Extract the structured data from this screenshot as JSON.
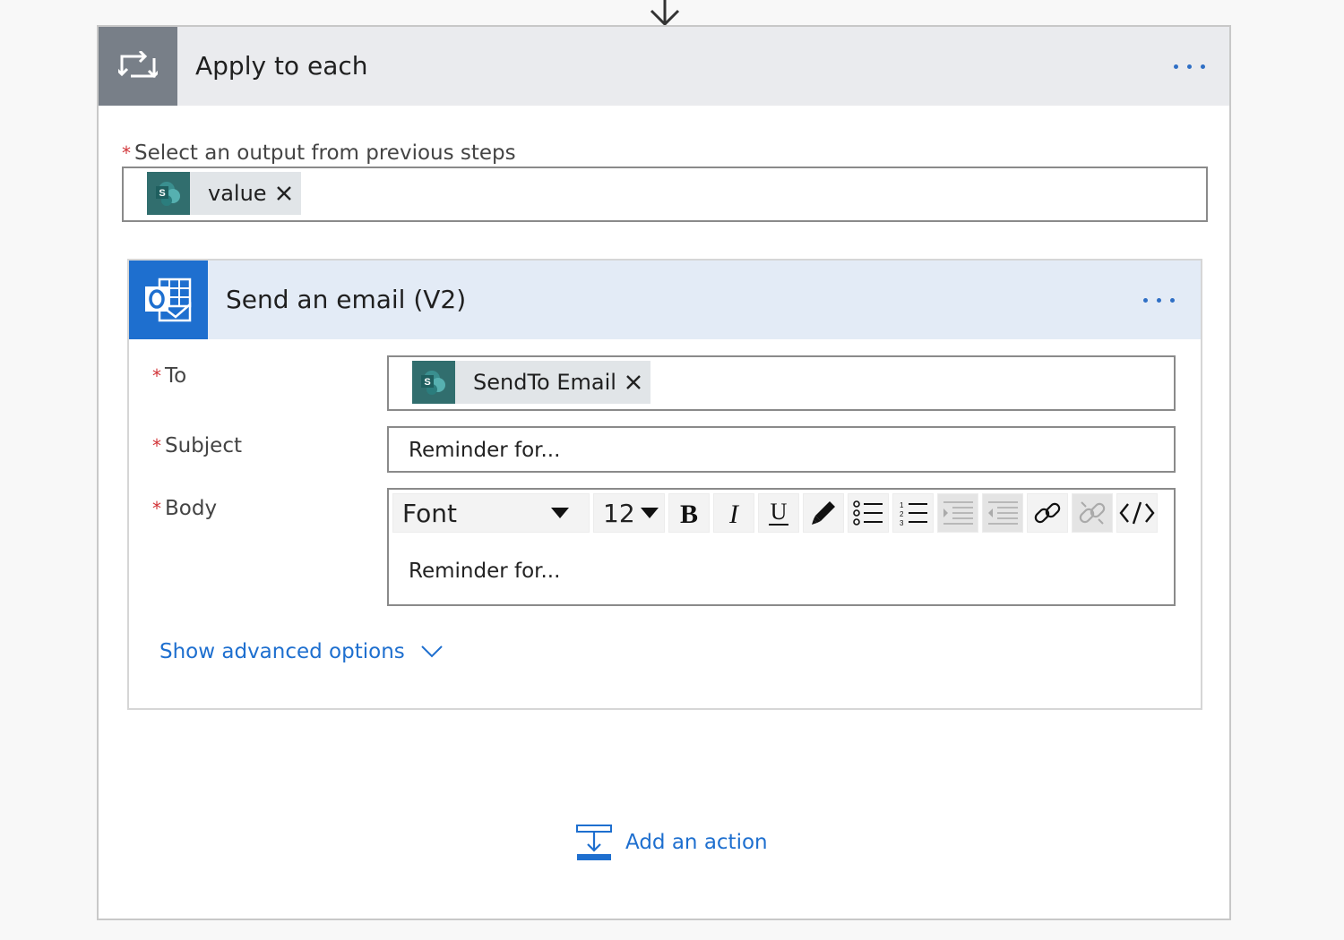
{
  "apply_to_each": {
    "title": "Apply to each",
    "select_output": {
      "required_mark": "*",
      "label": "Select an output from previous steps",
      "token_label": "value"
    }
  },
  "send_email": {
    "title": "Send an email (V2)",
    "to": {
      "required_mark": "*",
      "label": "To",
      "token_label": "SendTo Email"
    },
    "subject": {
      "required_mark": "*",
      "label": "Subject",
      "value": "Reminder for..."
    },
    "body": {
      "required_mark": "*",
      "label": "Body",
      "value": "Reminder for...",
      "toolbar": {
        "font_label": "Font",
        "size_label": "12"
      }
    },
    "show_advanced_label": "Show advanced options"
  },
  "add_action_label": "Add an action",
  "colors": {
    "accent": "#1e6fcf",
    "required": "#d13438",
    "sharepoint": "#316e6e",
    "loop_icon_bg": "#787f88"
  },
  "icons": {
    "loop": "loop-icon",
    "sharepoint": "sharepoint-icon",
    "outlook": "outlook-icon"
  }
}
